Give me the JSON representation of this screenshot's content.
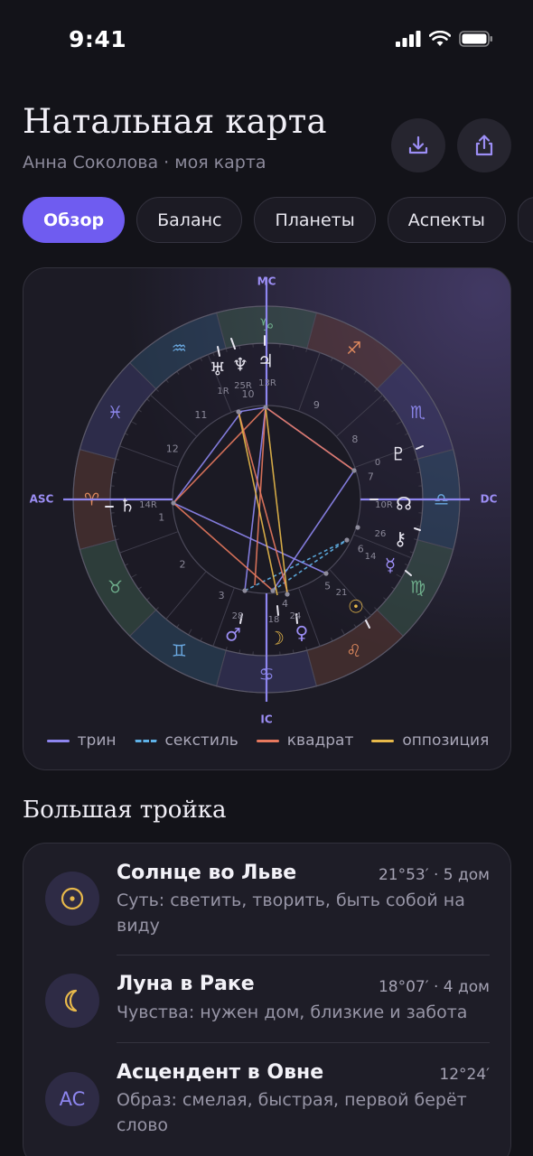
{
  "status": {
    "time": "9:41"
  },
  "header": {
    "title": "Натальная карта",
    "subtitle": "Анна Соколова · моя карта"
  },
  "tabs": [
    {
      "label": "Обзор",
      "active": true
    },
    {
      "label": "Баланс",
      "active": false
    },
    {
      "label": "Планеты",
      "active": false
    },
    {
      "label": "Аспекты",
      "active": false
    }
  ],
  "chart": {
    "axes": {
      "mc": "MC",
      "ic": "IC",
      "asc": "ASC",
      "dc": "DC"
    },
    "signs": [
      {
        "glyph": "♑",
        "name": "capricorn",
        "color": "#6fae8c"
      },
      {
        "glyph": "♐",
        "name": "sagittarius",
        "color": "#e08a5e"
      },
      {
        "glyph": "♏",
        "name": "scorpio",
        "color": "#8a84e8"
      },
      {
        "glyph": "♎",
        "name": "libra",
        "color": "#6aa8e0"
      },
      {
        "glyph": "♍",
        "name": "virgo",
        "color": "#6fae8c"
      },
      {
        "glyph": "♌",
        "name": "leo",
        "color": "#e08a5e"
      },
      {
        "glyph": "♋",
        "name": "cancer",
        "color": "#8a84e8"
      },
      {
        "glyph": "♊",
        "name": "gemini",
        "color": "#6aa8e0"
      },
      {
        "glyph": "♉",
        "name": "taurus",
        "color": "#6fae8c"
      },
      {
        "glyph": "♈",
        "name": "aries",
        "color": "#e08a5e"
      },
      {
        "glyph": "♓",
        "name": "pisces",
        "color": "#8a84e8"
      },
      {
        "glyph": "♒",
        "name": "aquarius",
        "color": "#6aa8e0"
      }
    ],
    "houses": [
      "1",
      "2",
      "3",
      "4",
      "5",
      "6",
      "7",
      "8",
      "9",
      "10",
      "11",
      "12"
    ],
    "planets": [
      {
        "glyph": "♅",
        "name": "uranus",
        "degree": "1R",
        "color": "#e6e4ee"
      },
      {
        "glyph": "♆",
        "name": "neptune",
        "degree": "25R",
        "color": "#e6e4ee"
      },
      {
        "glyph": "♃",
        "name": "jupiter",
        "degree": "13R",
        "color": "#e6e4ee"
      },
      {
        "glyph": "♇",
        "name": "pluto",
        "degree": "0",
        "color": "#e6e4ee"
      },
      {
        "glyph": "☊",
        "name": "node",
        "degree": "10R",
        "color": "#e6e4ee"
      },
      {
        "glyph": "⚷",
        "name": "chiron",
        "degree": "26",
        "color": "#e6e4ee"
      },
      {
        "glyph": "☿",
        "name": "mercury",
        "degree": "14",
        "color": "#9c8ef5"
      },
      {
        "glyph": "☉",
        "name": "sun",
        "degree": "21",
        "color": "#e8b94a"
      },
      {
        "glyph": "☽",
        "name": "moon",
        "degree": "18",
        "color": "#e8b94a"
      },
      {
        "glyph": "♀",
        "name": "venus",
        "degree": "24",
        "color": "#9c8ef5"
      },
      {
        "glyph": "♂",
        "name": "mars",
        "degree": "28",
        "color": "#9c8ef5"
      },
      {
        "glyph": "♄",
        "name": "saturn",
        "degree": "14R",
        "color": "#e6e4ee"
      }
    ],
    "legend": [
      {
        "label": "трин",
        "color": "#8e86f0",
        "style": "solid"
      },
      {
        "label": "секстиль",
        "color": "#5fb2e8",
        "style": "dashed"
      },
      {
        "label": "квадрат",
        "color": "#e8795e",
        "style": "solid"
      },
      {
        "label": "оппозиция",
        "color": "#e8b94a",
        "style": "solid"
      }
    ]
  },
  "big_three": {
    "title": "Большая тройка",
    "items": [
      {
        "icon": "☉",
        "icon_name": "sun-icon",
        "name": "Солнце во Льве",
        "position": "21°53′ · 5 дом",
        "description": "Суть: светить, творить, быть собой на виду"
      },
      {
        "icon": "☾",
        "icon_name": "moon-icon",
        "name": "Луна в Раке",
        "position": "18°07′ · 4 дом",
        "description": "Чувства: нужен дом, близкие и забота"
      },
      {
        "icon": "AC",
        "icon_name": "ascendant-icon",
        "name": "Асцендент в Овне",
        "position": "12°24′",
        "description": "Образ: смелая, быстрая, первой берёт слово"
      }
    ]
  },
  "colors": {
    "accent": "#6f5cf0",
    "background": "#131319",
    "card": "#1e1d27",
    "gold": "#e8b94a"
  }
}
